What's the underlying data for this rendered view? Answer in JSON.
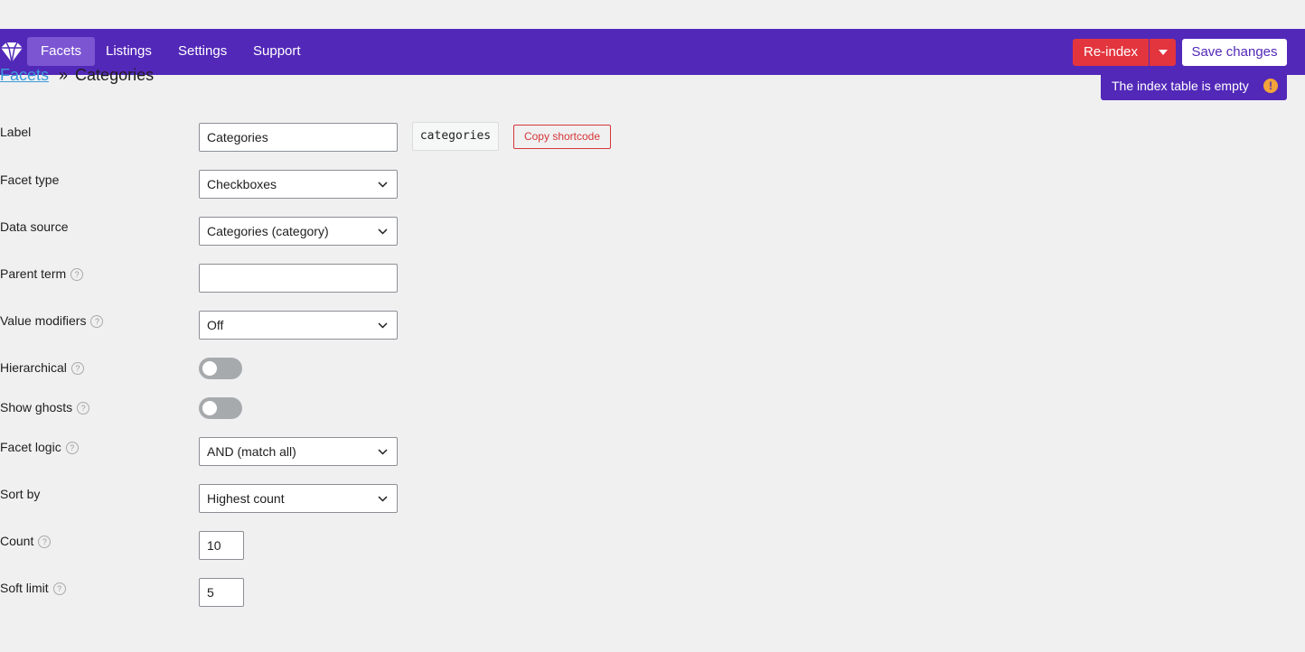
{
  "nav": {
    "items": [
      {
        "label": "Facets",
        "active": true
      },
      {
        "label": "Listings"
      },
      {
        "label": "Settings"
      },
      {
        "label": "Support"
      }
    ],
    "reindex_label": "Re-index",
    "save_label": "Save changes"
  },
  "breadcrumb": {
    "parent": "Facets",
    "separator": "»",
    "current": "Categories"
  },
  "notice": {
    "text": "The index table is empty",
    "icon": "!"
  },
  "form": {
    "label": {
      "label": "Label",
      "value": "Categories",
      "shortcode": "categories",
      "copy_label": "Copy shortcode"
    },
    "facet_type": {
      "label": "Facet type",
      "value": "Checkboxes"
    },
    "data_source": {
      "label": "Data source",
      "value": "Categories (category)"
    },
    "parent_term": {
      "label": "Parent term",
      "value": ""
    },
    "value_modifiers": {
      "label": "Value modifiers",
      "value": "Off"
    },
    "hierarchical": {
      "label": "Hierarchical",
      "on": false
    },
    "show_ghosts": {
      "label": "Show ghosts",
      "on": false
    },
    "facet_logic": {
      "label": "Facet logic",
      "value": "AND (match all)"
    },
    "sort_by": {
      "label": "Sort by",
      "value": "Highest count"
    },
    "count": {
      "label": "Count",
      "value": "10"
    },
    "soft_limit": {
      "label": "Soft limit",
      "value": "5"
    },
    "help_glyph": "?"
  },
  "colors": {
    "topbar": "#5228b8",
    "active_nav": "#7c55d3",
    "reindex": "#e3353e",
    "link": "#3a9bd9",
    "warning": "#f2a33a"
  }
}
